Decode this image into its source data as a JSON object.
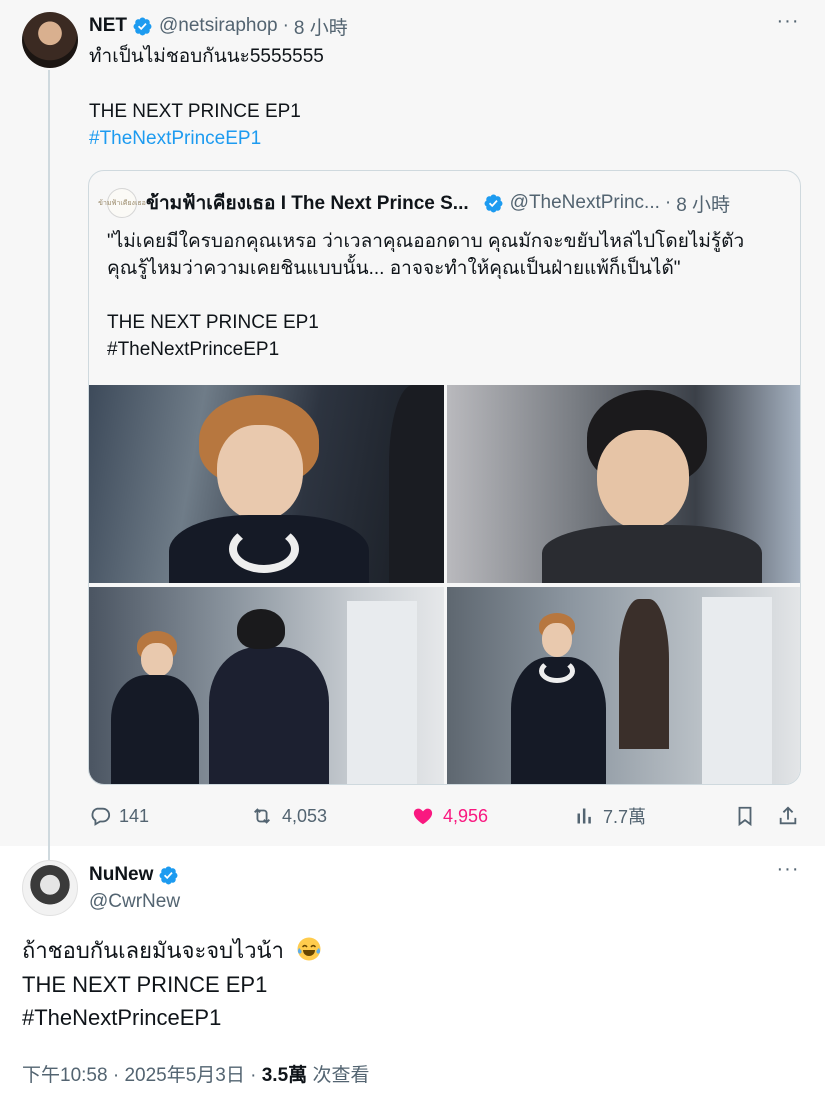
{
  "parent_tweet": {
    "author_name": "NET",
    "handle": "@netsiraphop",
    "separator": "·",
    "time": "8 小時",
    "text_line1": "ทำเป็นไม่ชอบกันนะ5555555",
    "text_line2": "THE NEXT PRINCE EP1",
    "hashtag": "#TheNextPrinceEP1",
    "more_label": "···",
    "quote": {
      "avatar_text": "ข้ามฟ้าเคียงเธอ",
      "author_name": "ข้ามฟ้าเคียงเธอ I The Next Prince S...",
      "handle": "@TheNextPrinc...",
      "separator": "·",
      "time": "8 小時",
      "line1": "\"ไม่เคยมีใครบอกคุณเหรอ ว่าเวลาคุณออกดาบ คุณมักจะขยับไหล่ไปโดยไม่รู้ตัว",
      "line2": "คุณรู้ไหมว่าความเคยชินแบบนั้น... อาจจะทำให้คุณเป็นฝ่ายแพ้ก็เป็นได้\"",
      "line3": "THE NEXT PRINCE EP1",
      "line4": "#TheNextPrinceEP1"
    },
    "actions": {
      "replies": "141",
      "reposts": "4,053",
      "likes": "4,956",
      "views": "7.7萬"
    }
  },
  "main_tweet": {
    "author_name": "NuNew",
    "handle": "@CwrNew",
    "more_label": "···",
    "text_line1": "ถ้าชอบกันเลยมันจะจบไวน้า",
    "text_line2": "THE NEXT PRINCE EP1",
    "hashtag": "#TheNextPrinceEP1",
    "time": "下午10:58",
    "separator": "·",
    "date": "2025年5月3日",
    "separator2": "·",
    "views_count": "3.5萬",
    "views_label": "次查看"
  },
  "colors": {
    "link": "#1d9bf0",
    "like": "#f91880",
    "muted": "#536471",
    "verified": "#1d9bf0"
  },
  "icons": [
    "verified-badge-icon",
    "more-icon",
    "reply-icon",
    "repost-icon",
    "heart-icon",
    "views-icon",
    "bookmark-icon",
    "share-icon",
    "laughing-emoji-icon"
  ]
}
